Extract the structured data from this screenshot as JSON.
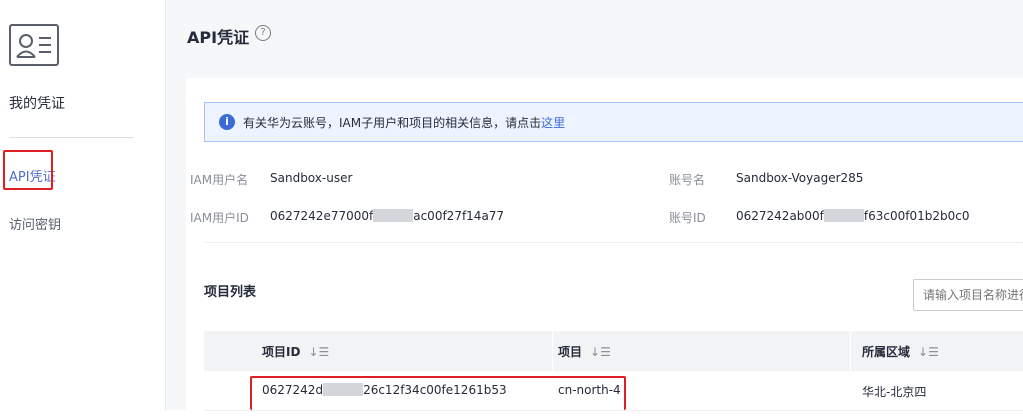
{
  "sidebar": {
    "title": "我的凭证",
    "nav": [
      {
        "label": "API凭证",
        "active": true
      },
      {
        "label": "访问密钥",
        "active": false
      }
    ]
  },
  "header": {
    "title": "API凭证",
    "help_icon": "question-circle-icon"
  },
  "notice": {
    "text": "有关华为云账号，IAM子用户和项目的相关信息，请点击",
    "link": "这里",
    "icon": "info-icon"
  },
  "account": {
    "iam_user_label": "IAM用户名",
    "iam_user_value": "Sandbox-user",
    "iam_id_label": "IAM用户ID",
    "iam_id_prefix": "0627242e77000f",
    "iam_id_suffix": "ac00f27f14a77",
    "account_name_label": "账号名",
    "account_name_value": "Sandbox-Voyager285",
    "account_id_label": "账号ID",
    "account_id_prefix": "0627242ab00f",
    "account_id_suffix": "f63c00f01b2b0c0"
  },
  "projects": {
    "title": "项目列表",
    "search_placeholder": "请输入项目名称进行",
    "columns": [
      "项目ID",
      "项目",
      "所属区域"
    ],
    "rows": [
      {
        "id_prefix": "0627242d",
        "id_suffix": "26c12f34c00fe1261b53",
        "project": "cn-north-4",
        "region": "华北-北京四"
      }
    ]
  },
  "colors": {
    "accent": "#526ecc",
    "highlight": "#e02020",
    "notice_bg": "#eef4ff"
  }
}
